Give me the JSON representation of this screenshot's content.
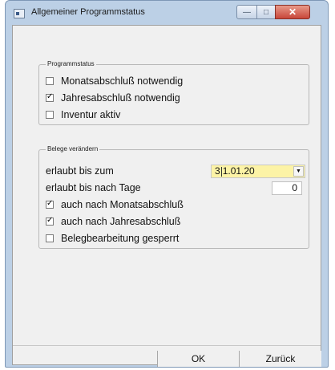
{
  "window": {
    "title": "Allgemeiner Programmstatus",
    "controls": {
      "minimize": "—",
      "maximize": "□",
      "close": "✕"
    }
  },
  "programmstatus": {
    "title": "Programmstatus",
    "items": [
      {
        "label": "Monatsabschluß notwendig",
        "checked": false
      },
      {
        "label": "Jahresabschluß notwendig",
        "checked": true
      },
      {
        "label": "Inventur aktiv",
        "checked": false
      }
    ]
  },
  "belege": {
    "title": "Belege verändern",
    "erlaubt_bis_zum_label": "erlaubt bis zum",
    "date_value_prefix": "3",
    "date_value_rest": "1.01.20",
    "erlaubt_bis_tage_label": "erlaubt bis nach Tage",
    "tage_value": "0",
    "checks": [
      {
        "label": "auch nach Monatsabschluß",
        "checked": true
      },
      {
        "label": "auch nach Jahresabschluß",
        "checked": true
      },
      {
        "label": "Belegbearbeitung gesperrt",
        "checked": false
      }
    ]
  },
  "buttons": {
    "ok": "OK",
    "back": "Zurück"
  },
  "colors": {
    "date_field_bg": "#fcf3a6",
    "close_button": "#c8463a",
    "frame": "#bcd0e6"
  }
}
